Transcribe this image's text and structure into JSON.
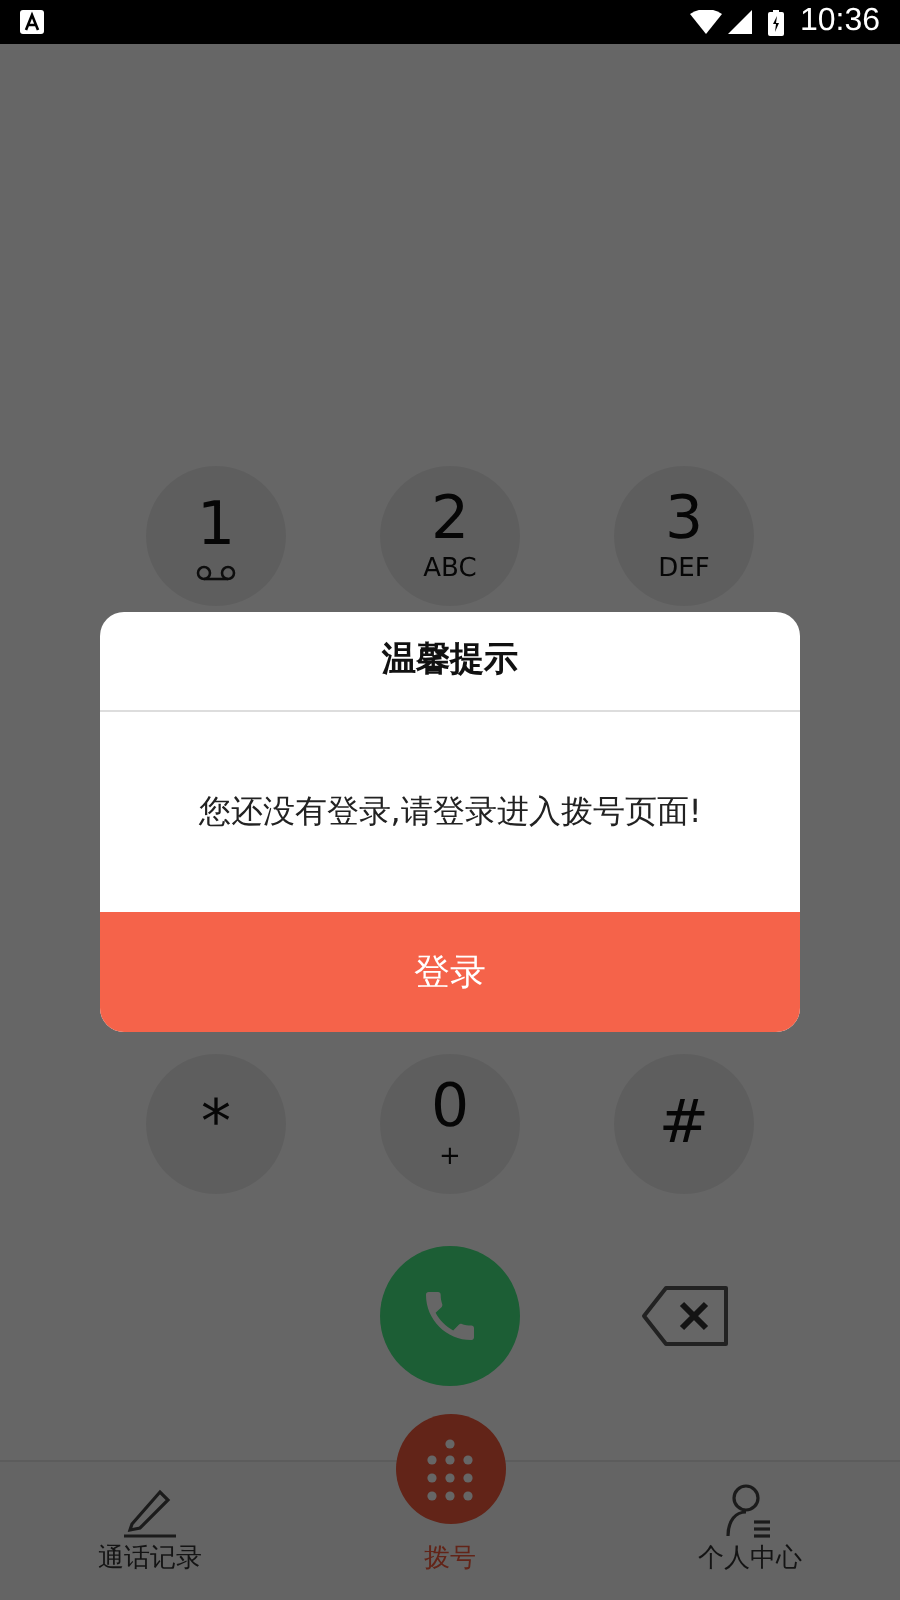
{
  "status_bar": {
    "time": "10:36"
  },
  "dialpad": {
    "rows": [
      [
        {
          "digit": "1",
          "kind": "voicemail"
        },
        {
          "digit": "2",
          "kind": "letters",
          "letters": "ABC"
        },
        {
          "digit": "3",
          "kind": "letters",
          "letters": "DEF"
        }
      ],
      [
        {
          "digit": "*",
          "kind": "plain"
        },
        {
          "digit": "0",
          "kind": "letters",
          "letters": "+"
        },
        {
          "digit": "#",
          "kind": "plain"
        }
      ]
    ]
  },
  "dialog": {
    "title": "温馨提示",
    "message": "您还没有登录,请登录进入拨号页面!",
    "button": "登录"
  },
  "nav": {
    "items": [
      {
        "kind": "history",
        "label": "通话记录",
        "selected": false
      },
      {
        "kind": "dial",
        "label": "拨号",
        "selected": true
      },
      {
        "kind": "profile",
        "label": "个人中心",
        "selected": false
      }
    ]
  }
}
